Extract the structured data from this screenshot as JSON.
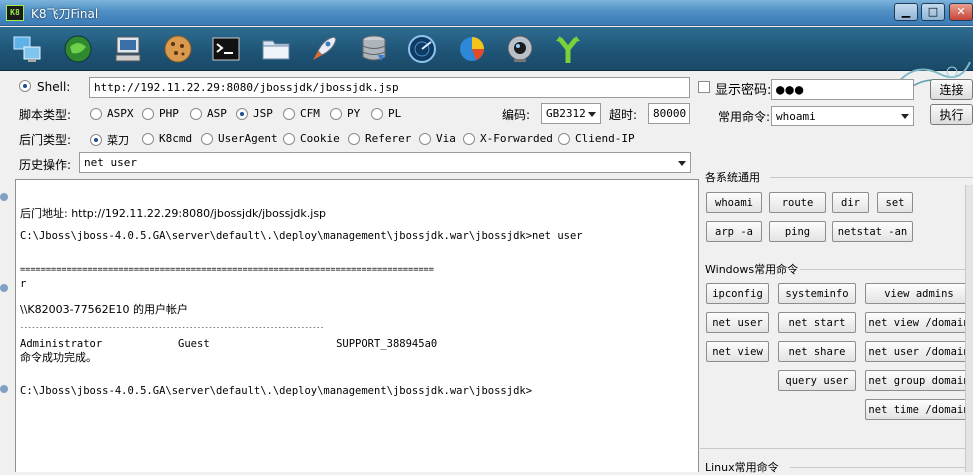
{
  "window": {
    "title": "K8飞刀Final",
    "min_label": "▁",
    "max_label": "□",
    "close_label": "✕"
  },
  "toolbar": {
    "tools": [
      {
        "icon": "computers-icon"
      },
      {
        "icon": "green-orb-icon"
      },
      {
        "icon": "pc-icon"
      },
      {
        "icon": "cookie-icon"
      },
      {
        "icon": "terminal-icon"
      },
      {
        "icon": "folder-icon"
      },
      {
        "icon": "rocket-icon"
      },
      {
        "icon": "database-icon"
      },
      {
        "icon": "radar-icon"
      },
      {
        "icon": "pie-chart-icon"
      },
      {
        "icon": "webcam-icon"
      },
      {
        "icon": "fork-arrow-icon"
      }
    ]
  },
  "shell": {
    "label": "Shell:",
    "url": "http://192.11.22.29:8080/jbossjdk/jbossjdk.jsp",
    "show_password_label": "显示密码:",
    "password_mask": "●●●",
    "connect_label": "连接"
  },
  "script_type": {
    "label": "脚本类型:",
    "options": [
      "ASPX",
      "PHP",
      "ASP",
      "JSP",
      "CFM",
      "PY",
      "PL"
    ],
    "selected": "JSP",
    "encoding_label": "编码:",
    "encoding_value": "GB2312",
    "timeout_label": "超时:",
    "timeout_value": "80000"
  },
  "common_cmd": {
    "label": "常用命令:",
    "value": "whoami",
    "execute_label": "执行"
  },
  "backdoor_type": {
    "label": "后门类型:",
    "options": [
      "菜刀",
      "K8cmd",
      "UserAgent",
      "Cookie",
      "Referer",
      "Via",
      "X-Forwarded",
      "Cliend-IP"
    ],
    "selected": "菜刀"
  },
  "history": {
    "label": "历史操作:",
    "value": "net user"
  },
  "output": {
    "lines": [
      "后门地址: http://192.11.22.29:8080/jbossjdk/jbossjdk.jsp",
      "C:\\Jboss\\jboss-4.0.5.GA\\server\\default\\.\\deploy\\management\\jbossjdk.war\\jbossjdk>net user",
      "================================================================================",
      "r",
      "\\\\K82003-77562E10 的用户帐户",
      "-------------------------------------------------------------------------------",
      "Administrator            Guest                    SUPPORT_388945a0",
      "命令成功完成。",
      "C:\\Jboss\\jboss-4.0.5.GA\\server\\default\\.\\deploy\\management\\jbossjdk.war\\jbossjdk>"
    ]
  },
  "panel": {
    "general_title": "各系统通用",
    "general_buttons": [
      "whoami",
      "route",
      "dir",
      "set",
      "arp -a",
      "ping",
      "netstat -an"
    ],
    "windows_title": "Windows常用命令",
    "windows_buttons": [
      "ipconfig",
      "systeminfo",
      "view admins",
      "net user",
      "net start",
      "net view /domain",
      "net view",
      "net share",
      "net user /domain",
      "query user",
      "net group domain",
      "net time /domain"
    ],
    "linux_title": "Linux常用命令"
  },
  "colors": {
    "titlebar": "#4f8fc4",
    "toolbar": "#1e5375",
    "radio_selected": "#1b4f8f"
  }
}
